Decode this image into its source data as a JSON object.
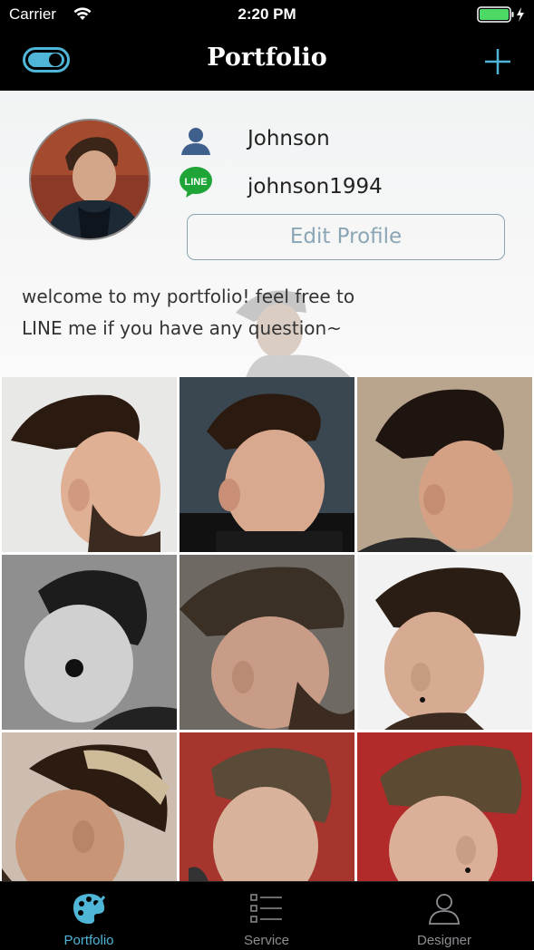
{
  "status_bar": {
    "carrier": "Carrier",
    "time": "2:20 PM"
  },
  "nav": {
    "title": "Portfolio"
  },
  "profile": {
    "name": "Johnson",
    "line_id": "johnson1994",
    "edit_button": "Edit Profile",
    "bio_line1": "welcome to my portfolio! feel free to",
    "bio_line2": "LINE me if you have any question~",
    "line_badge": "LINE"
  },
  "gallery": {
    "photo_count": 9
  },
  "tabs": [
    {
      "label": "Portfolio",
      "active": true
    },
    {
      "label": "Service",
      "active": false
    },
    {
      "label": "Designer",
      "active": false
    }
  ],
  "colors": {
    "accent": "#4fb6d8",
    "line_green": "#1fa537",
    "battery": "#4cd964",
    "inactive_tab": "#8e8e93"
  }
}
